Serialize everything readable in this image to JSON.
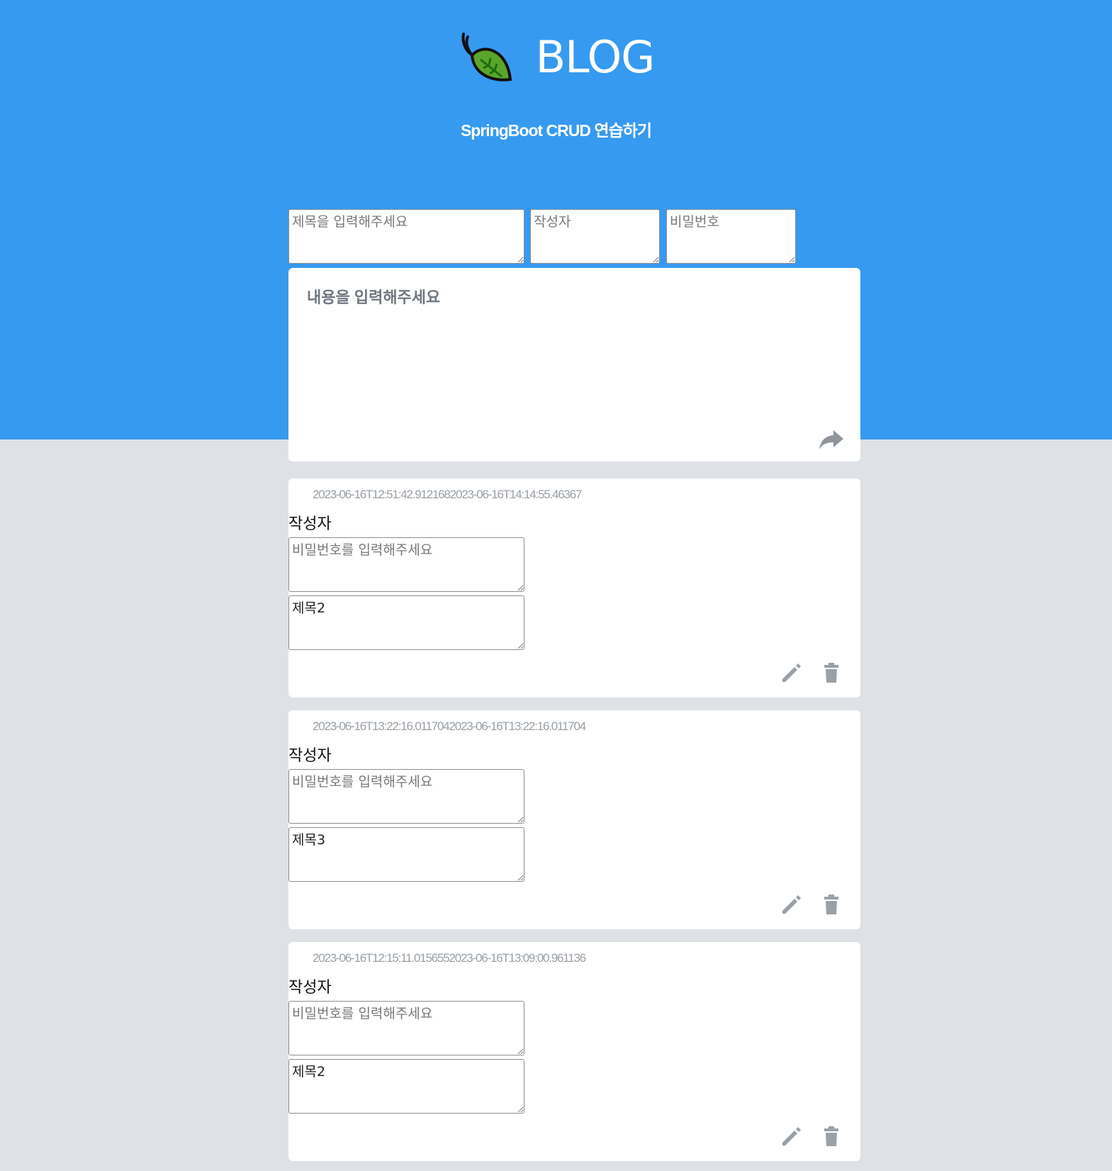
{
  "header": {
    "title": "BLOG",
    "subtitle": "SpringBoot CRUD 연습하기"
  },
  "form": {
    "title_placeholder": "제목을 입력해주세요",
    "author_placeholder": "작성자",
    "password_placeholder": "비밀번호",
    "content_placeholder": "내용을 입력해주세요",
    "submit_icon": "share-arrow-icon"
  },
  "posts": [
    {
      "dates": "2023-06-16T12:51:42.9121682023-06-16T14:14:55.46367",
      "author": "작성자",
      "password_placeholder": "비밀번호를 입력해주세요",
      "title": "제목2"
    },
    {
      "dates": "2023-06-16T13:22:16.0117042023-06-16T13:22:16.011704",
      "author": "작성자",
      "password_placeholder": "비밀번호를 입력해주세요",
      "title": "제목3"
    },
    {
      "dates": "2023-06-16T12:15:11.0156552023-06-16T13:09:00.961136",
      "author": "작성자",
      "password_placeholder": "비밀번호를 입력해주세요",
      "title": "제목2"
    }
  ],
  "icons": {
    "edit": "pencil-icon",
    "delete": "trash-icon"
  },
  "colors": {
    "header_bg": "#369af0",
    "page_bg": "#dee1e6",
    "icon_gray": "#9aa0a6"
  }
}
